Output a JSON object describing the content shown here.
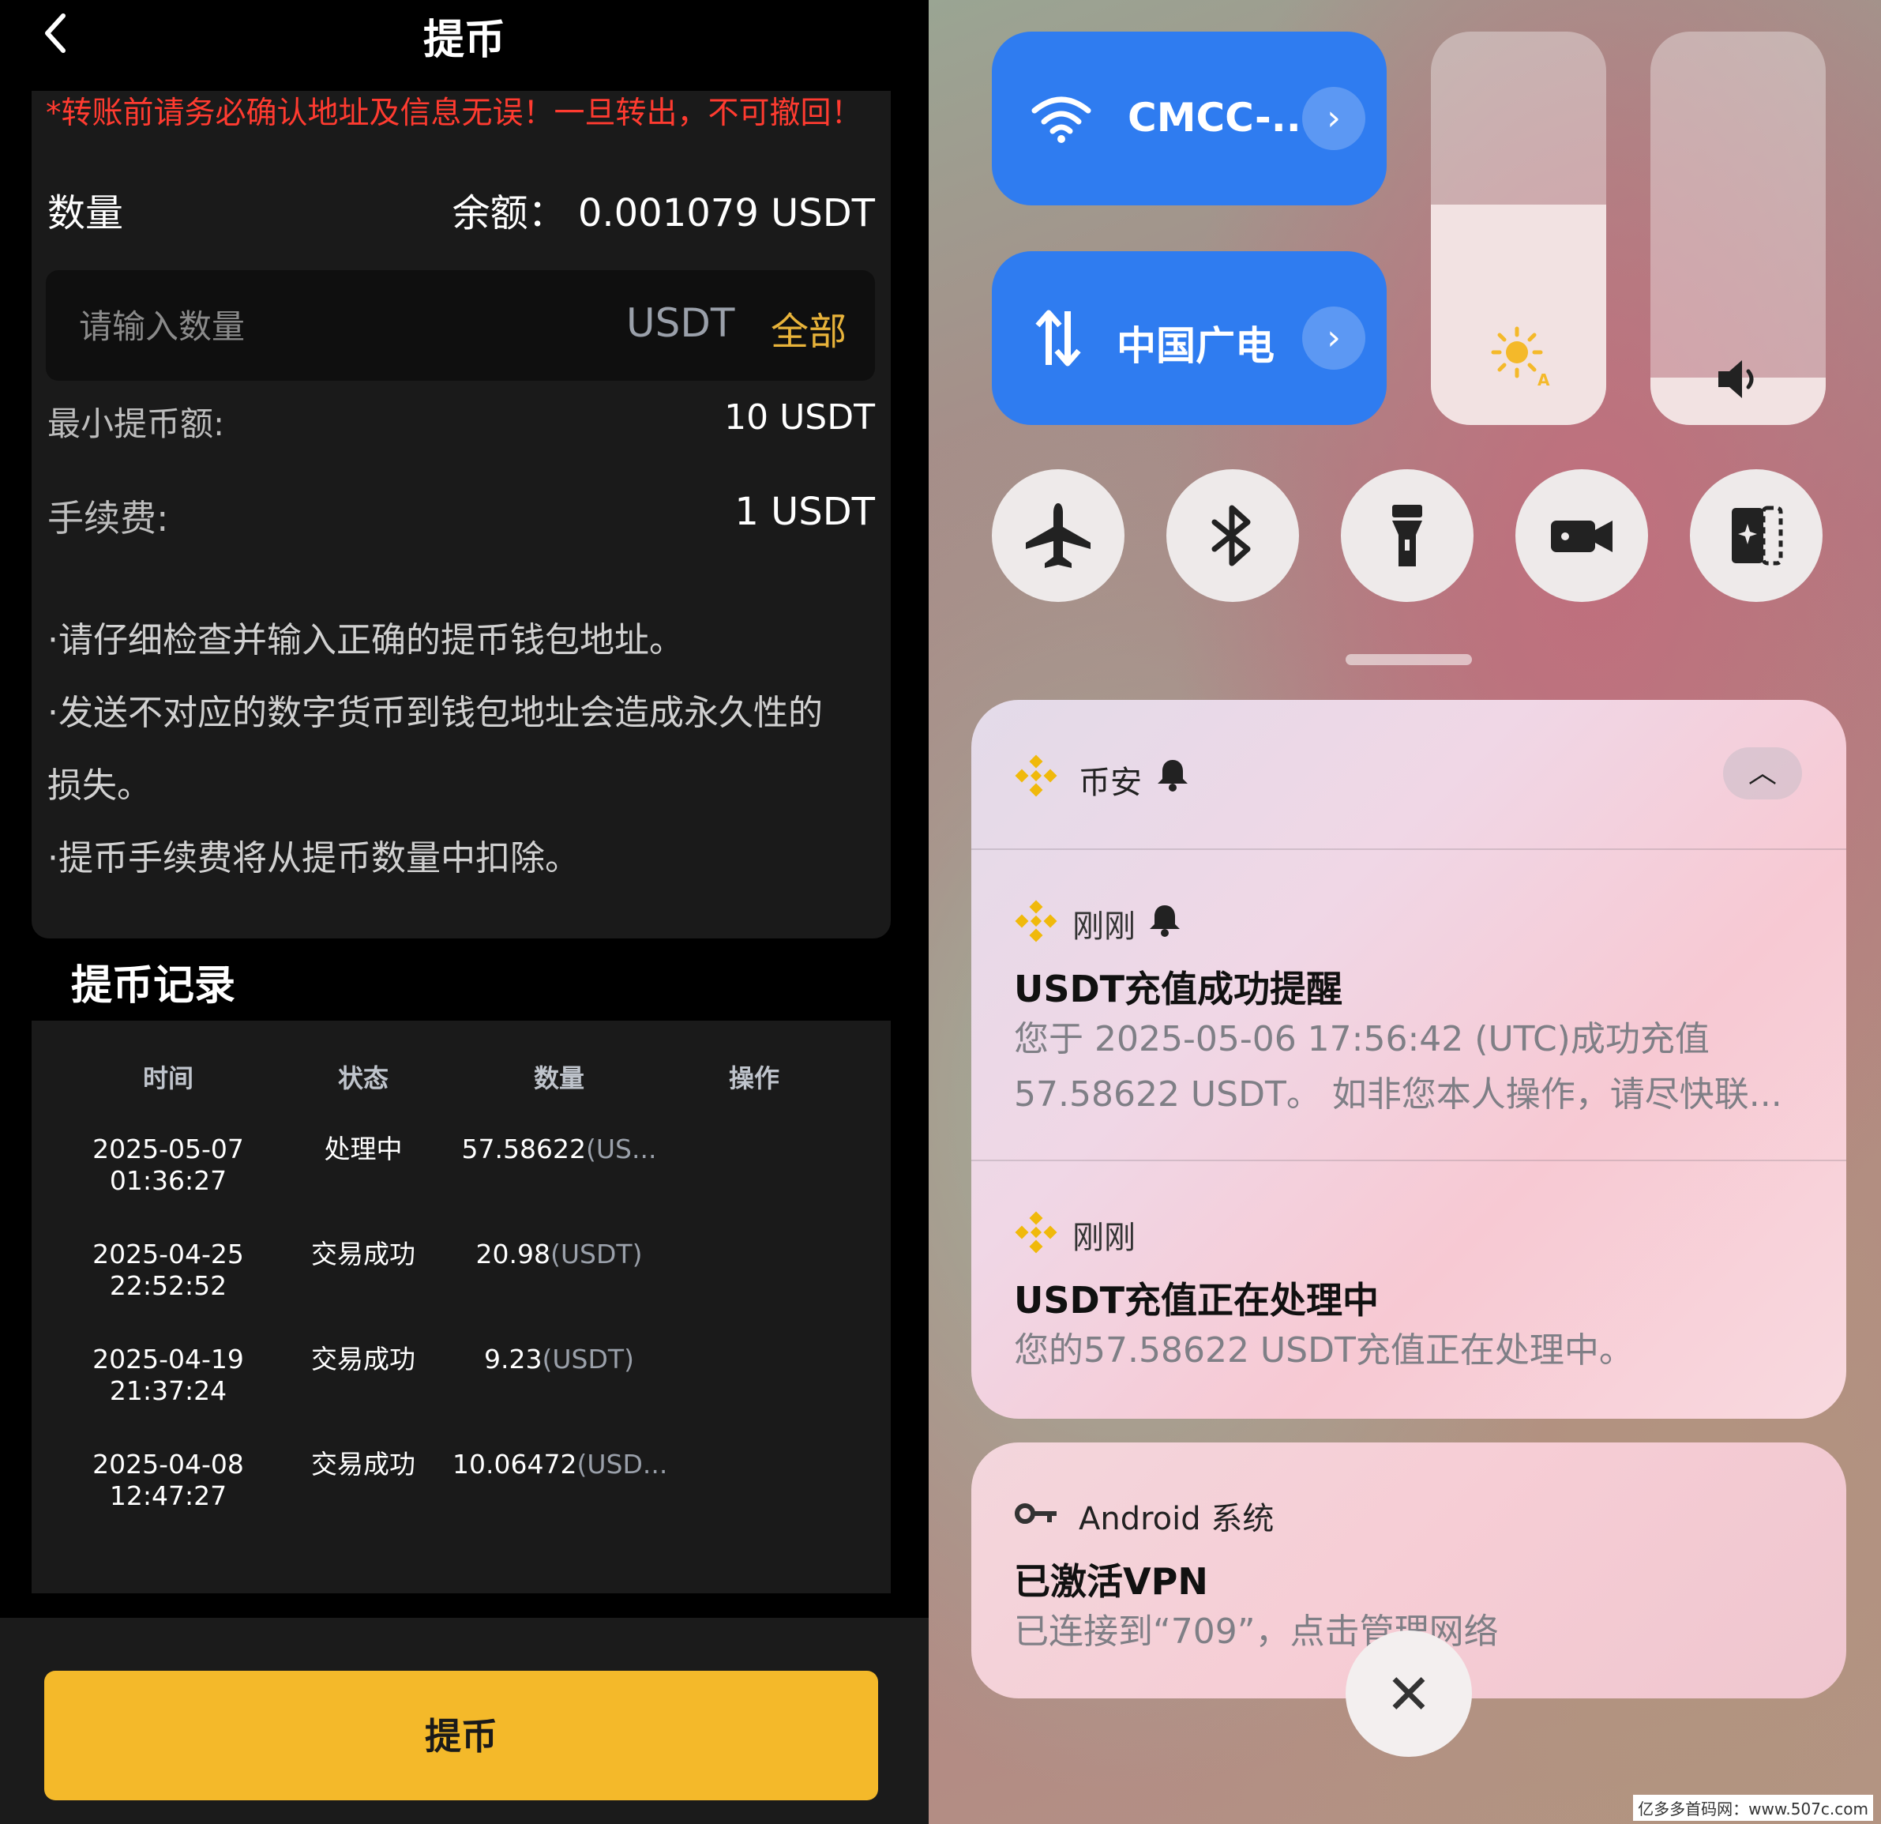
{
  "withdraw": {
    "back_icon": "chevron-left-icon",
    "title": "提币",
    "warning": "*转账前请务必确认地址及信息无误！一旦转出，不可撤回！",
    "qty_label": "数量",
    "balance": "余额： 0.001079 USDT",
    "input_placeholder": "请输入数量",
    "unit": "USDT",
    "all_label": "全部",
    "min_label": "最小提币额:",
    "min_value": "10 USDT",
    "fee_label": "手续费:",
    "fee_value": "1 USDT",
    "tips": [
      "·请仔细检查并输入正确的提币钱包地址。",
      "·发送不对应的数字货币到钱包地址会造成永久性的",
      "损失。",
      "·提币手续费将从提币数量中扣除。"
    ],
    "history_title": "提币记录",
    "columns": [
      "时间",
      "状态",
      "数量",
      "操作"
    ],
    "records": [
      {
        "date": "2025-05-07",
        "time": "01:36:27",
        "status": "处理中",
        "amount": "57.58622",
        "unit": "(US..."
      },
      {
        "date": "2025-04-25",
        "time": "22:52:52",
        "status": "交易成功",
        "amount": "20.98",
        "unit": "(USDT)"
      },
      {
        "date": "2025-04-19",
        "time": "21:37:24",
        "status": "交易成功",
        "amount": "9.23",
        "unit": "(USDT)"
      },
      {
        "date": "2025-04-08",
        "time": "12:47:27",
        "status": "交易成功",
        "amount": "10.06472",
        "unit": "(USD..."
      }
    ],
    "submit_label": "提币"
  },
  "control_center": {
    "wifi_label": "CMCC-..",
    "mobile_label": "中国广电",
    "brightness_level": 0.56,
    "volume_level": 0.12,
    "toggles": [
      "airplane-icon",
      "bluetooth-icon",
      "flashlight-icon",
      "video-camera-icon",
      "screen-cast-icon"
    ]
  },
  "notifications": {
    "group_app": "币安",
    "items": [
      {
        "time": "刚刚",
        "title": "USDT充值成功提醒",
        "body_line1": "您于 2025-05-06 17:56:42 (UTC)成功充值",
        "body_line2": "57.58622 USDT。 如非您本人操作，请尽快联..."
      },
      {
        "time": "刚刚",
        "title": "USDT充值正在处理中",
        "body_line1": "您的57.58622 USDT充值正在处理中。"
      }
    ],
    "vpn_app": "Android 系统",
    "vpn_title": "已激活VPN",
    "vpn_body": "已连接到“709”，点击管理网络"
  },
  "colors": {
    "accent_yellow": "#f4b92a",
    "warning_red": "#ff3b30",
    "tile_blue": "#2f7cf0"
  },
  "watermark": "亿多多首码网：www.507c.com"
}
